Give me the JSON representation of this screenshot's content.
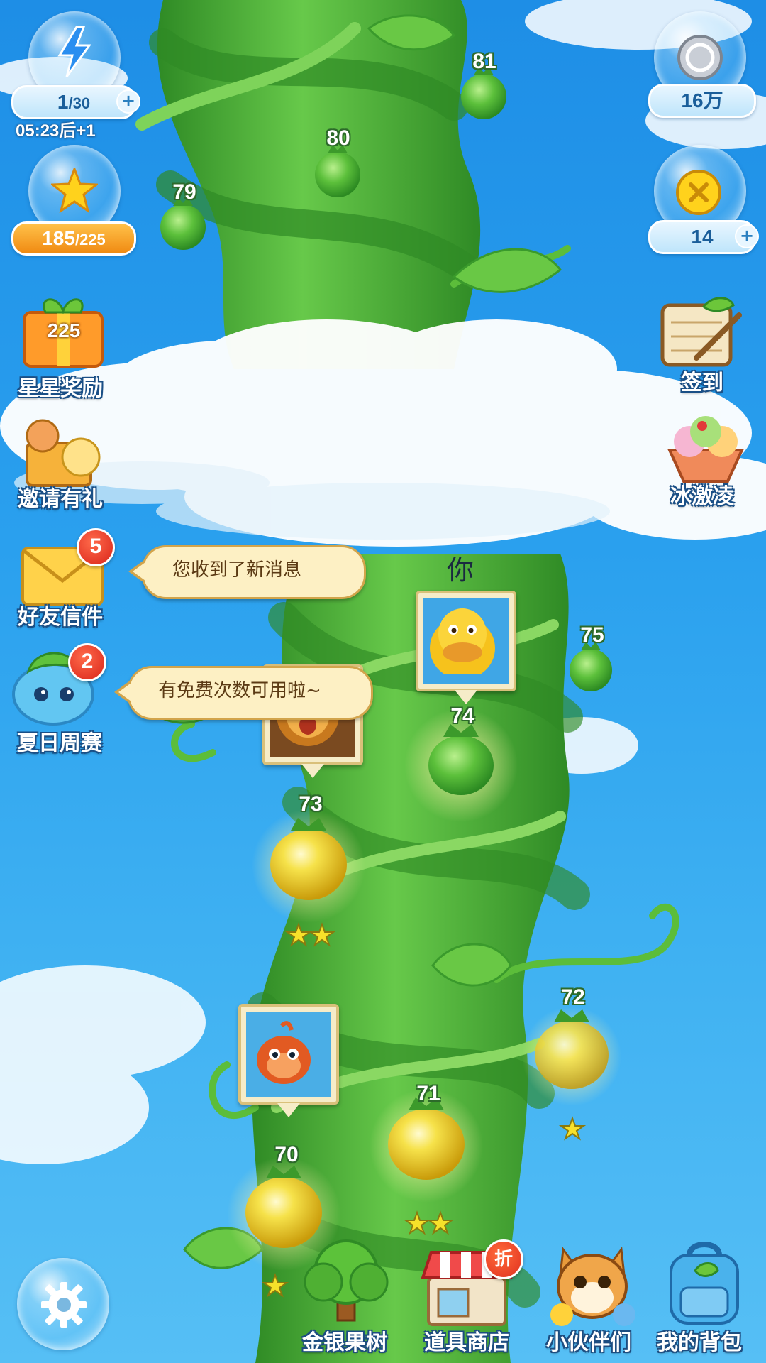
{
  "hud": {
    "energy": {
      "icon": "lightning-icon",
      "current": "1",
      "sep": "/",
      "max": "30",
      "timer": "05:23",
      "timer_suffix": "后+1"
    },
    "stars": {
      "icon": "star-icon",
      "current": "185",
      "sep": "/",
      "max": "225"
    },
    "silver": {
      "icon": "silver-coin-icon",
      "value": "16万"
    },
    "gold": {
      "icon": "gold-coin-icon",
      "value": "14"
    }
  },
  "left_menu": {
    "star_reward": {
      "label": "星星奖励",
      "box_number": "225"
    },
    "invite": {
      "label": "邀请有礼"
    },
    "friend_mail": {
      "label": "好友信件",
      "badge": "5"
    },
    "summer_weekly": {
      "label": "夏日周赛",
      "badge": "2"
    }
  },
  "right_menu": {
    "checkin": {
      "label": "签到"
    },
    "ice_cream": {
      "label": "冰激凌"
    }
  },
  "tooltips": {
    "new_message": "您收到了新消息",
    "free_times": "有免费次数可用啦~"
  },
  "map": {
    "you_label": "你",
    "levels": [
      {
        "number": "70",
        "stars": 1,
        "completed": true
      },
      {
        "number": "71",
        "stars": 2,
        "completed": true
      },
      {
        "number": "72",
        "stars": 1,
        "completed": true
      },
      {
        "number": "73",
        "stars": 2,
        "completed": true
      },
      {
        "number": "74",
        "stars": 0,
        "completed": false,
        "current": true
      },
      {
        "number": "75",
        "stars": 0,
        "completed": false
      },
      {
        "number": "79",
        "stars": 0,
        "completed": false
      },
      {
        "number": "80",
        "stars": 0,
        "completed": false
      },
      {
        "number": "81",
        "stars": 0,
        "completed": false
      }
    ]
  },
  "bottom_nav": {
    "fruit_tree": {
      "label": "金银果树"
    },
    "shop": {
      "label": "道具商店",
      "badge": "折"
    },
    "partners": {
      "label": "小伙伴们"
    },
    "backpack": {
      "label": "我的背包"
    }
  },
  "settings": {
    "icon": "gear-icon"
  },
  "colors": {
    "sky": "#2aa0ee",
    "vine": "#4fb53a",
    "vine_dark": "#2f8a25",
    "tooltip_bg": "#fdf0c4",
    "badge_red": "#e0301f",
    "gold_fruit": "#f1d21e"
  }
}
